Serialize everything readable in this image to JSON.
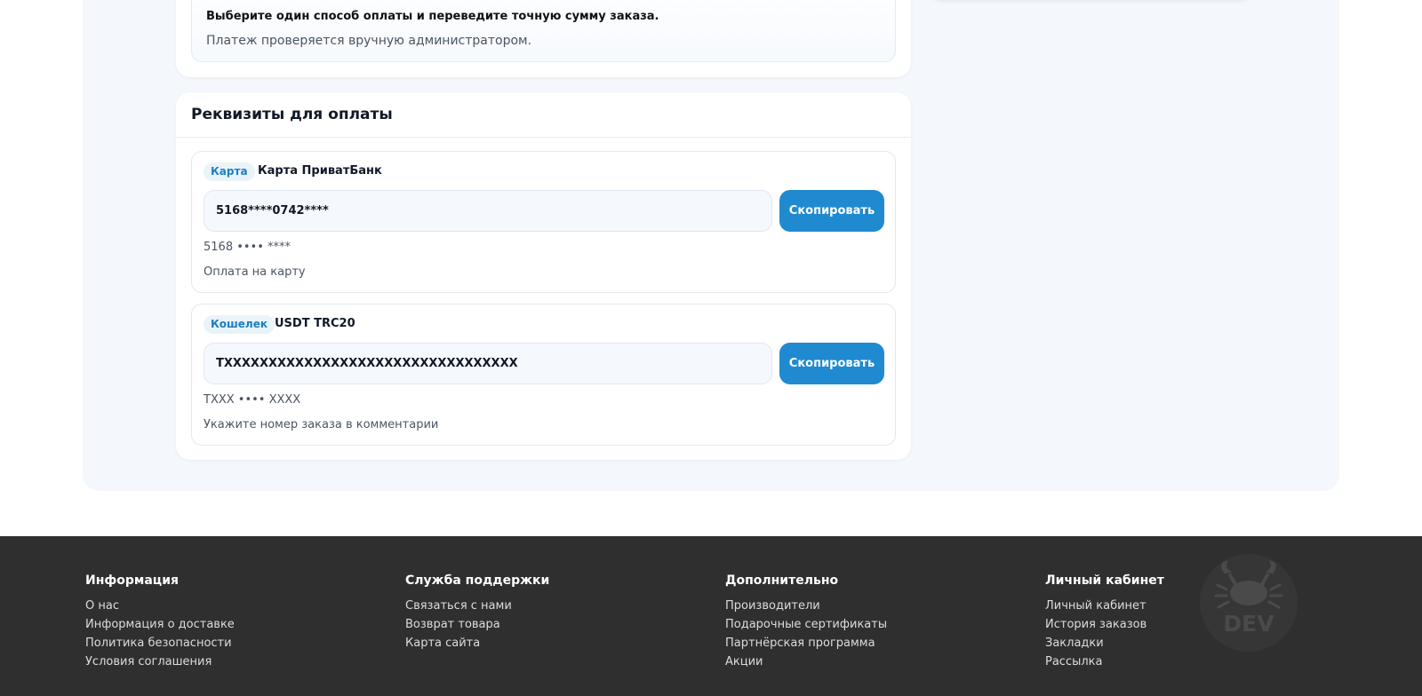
{
  "notice": {
    "title": "Выберите один способ оплаты и переведите точную сумму заказа.",
    "text": "Платеж проверяется вручную администратором."
  },
  "requisites": {
    "title": "Реквизиты для оплаты",
    "copy_label": "Скопировать",
    "methods": [
      {
        "badge": "Карта",
        "name": "Карта ПриватБанк",
        "value": "5168****0742****",
        "masked": "5168 •••• ****",
        "note": "Оплата на карту"
      },
      {
        "badge": "Кошелек",
        "name": "USDT TRC20",
        "value": "TXXXXXXXXXXXXXXXXXXXXXXXXXXXXXXXXX",
        "masked": "TXXX •••• XXXX",
        "note": "Укажите номер заказа в комментарии"
      }
    ]
  },
  "footer": {
    "columns": [
      {
        "title": "Информация",
        "links": [
          "О нас",
          "Информация о доставке",
          "Политика безопасности",
          "Условия соглашения"
        ]
      },
      {
        "title": "Служба поддержки",
        "links": [
          "Связаться с нами",
          "Возврат товара",
          "Карта сайта"
        ]
      },
      {
        "title": "Дополнительно",
        "links": [
          "Производители",
          "Подарочные сертификаты",
          "Партнёрская программа",
          "Акции"
        ]
      },
      {
        "title": "Личный кабинет",
        "links": [
          "Личный кабинет",
          "История заказов",
          "Закладки",
          "Рассылка"
        ]
      }
    ],
    "logo": {
      "icon": "crab-icon",
      "text": "DEV"
    }
  },
  "colors": {
    "accent": "#1f8ad0",
    "badge_bg": "#e9f3fa",
    "badge_text": "#1b7fc0",
    "footer_bg": "#2f2f2f",
    "page_panel": "#f4f7fb"
  }
}
